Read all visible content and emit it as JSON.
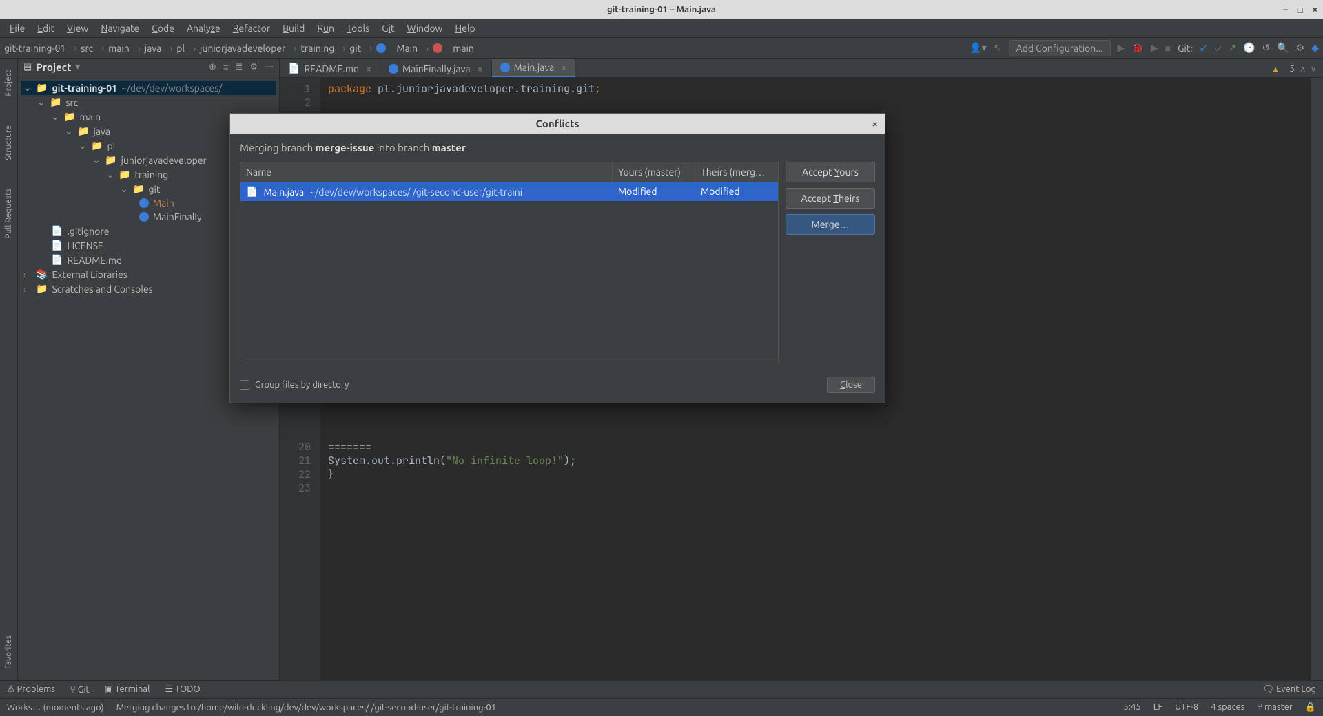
{
  "window": {
    "title": "git-training-01 – Main.java"
  },
  "menubar": [
    "File",
    "Edit",
    "View",
    "Navigate",
    "Code",
    "Analyze",
    "Refactor",
    "Build",
    "Run",
    "Tools",
    "Git",
    "Window",
    "Help"
  ],
  "breadcrumbs": [
    "git-training-01",
    "src",
    "main",
    "java",
    "pl",
    "juniorjavadeveloper",
    "training",
    "git",
    "Main",
    "main"
  ],
  "toolbar": {
    "add_config": "Add Configuration...",
    "git_label": "Git:"
  },
  "sidebar": {
    "title": "Project",
    "root": {
      "name": "git-training-01",
      "path": "~/dev/dev/workspaces/"
    },
    "tree": [
      "src",
      "main",
      "java",
      "pl",
      "juniorjavadeveloper",
      "training",
      "git"
    ],
    "files": {
      "main_cls": "Main",
      "finally_cls": "MainFinally",
      "gitignore": ".gitignore",
      "license": "LICENSE",
      "readme": "README.md"
    },
    "extra": {
      "ext_lib": "External Libraries",
      "scratches": "Scratches and Consoles"
    }
  },
  "leftrail": [
    "Project",
    "Structure",
    "Pull Requests",
    "Favorites"
  ],
  "tabs": [
    {
      "name": "README.md"
    },
    {
      "name": "MainFinally.java"
    },
    {
      "name": "Main.java"
    }
  ],
  "warnings": "5",
  "code": {
    "pkg": "package",
    "pkgpath": " pl.juniorjavadeveloper.training.git",
    "l20": "=======",
    "l21a": "            System.out.println(",
    "l21b": "\"No infinite loop!\"",
    "l21c": ");",
    "l22": "        }"
  },
  "gutter": {
    "g1": "1",
    "g2": "2",
    "g20": "20",
    "g21": "21",
    "g22": "22",
    "g23": "23"
  },
  "dialog": {
    "title": "Conflicts",
    "msg_pre": "Merging branch ",
    "msg_b1": "merge-issue",
    "msg_mid": " into branch ",
    "msg_b2": "master",
    "cols": {
      "name": "Name",
      "yours": "Yours (master)",
      "theirs": "Theirs (merg…"
    },
    "row": {
      "file": "Main.java",
      "path": "~/dev/dev/workspaces/          /git-second-user/git-traini",
      "yours": "Modified",
      "theirs": "Modified"
    },
    "btn_yours": "Accept Yours",
    "btn_theirs": "Accept Theirs",
    "btn_merge": "Merge…",
    "group_chk": "Group files by directory",
    "close": "Close"
  },
  "toolstrip": {
    "problems": "Problems",
    "git": "Git",
    "terminal": "Terminal",
    "todo": "TODO",
    "eventlog": "Event Log"
  },
  "statusbar": {
    "left1": "Works… (moments ago)",
    "left2": "Merging changes to /home/wild-duckling/dev/dev/workspaces/        /git-second-user/git-training-01",
    "pos": "5:45",
    "lf": "LF",
    "enc": "UTF-8",
    "indent": "4 spaces",
    "branch": "master"
  }
}
